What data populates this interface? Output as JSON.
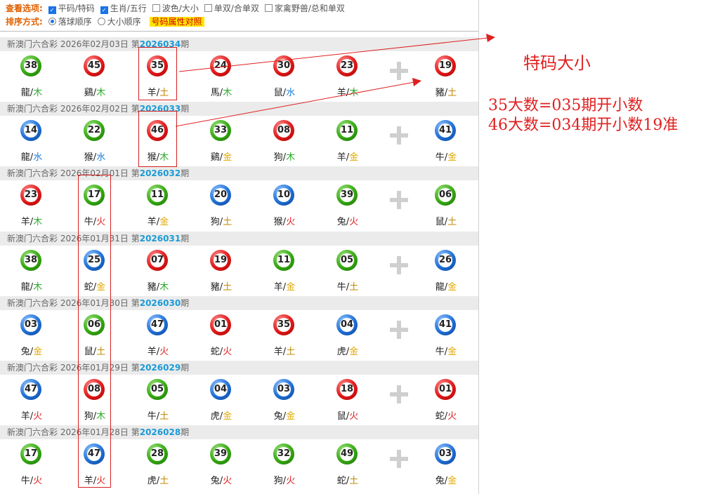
{
  "options": {
    "view_label": "查看选项:",
    "view_items": [
      {
        "label": "平码/特码",
        "checked": true
      },
      {
        "label": "生肖/五行",
        "checked": true
      },
      {
        "label": "波色/大小",
        "checked": false
      },
      {
        "label": "单双/合单双",
        "checked": false
      },
      {
        "label": "家禽野兽/总和单双",
        "checked": false
      }
    ],
    "sort_label": "排序方式:",
    "sort_items": [
      {
        "label": "落球顺序",
        "selected": true
      },
      {
        "label": "大小顺序",
        "selected": false
      }
    ],
    "attr_button": "号码属性对照"
  },
  "colors": {
    "red": "#e01818",
    "green": "#34a810",
    "blue": "#1f6fd6",
    "fire": "#e02020",
    "wood": "#2eaa2e",
    "water": "#1a7ad6",
    "metal": "#e0a800",
    "earth": "#c08a00"
  },
  "draws": [
    {
      "prefix": "新澳门六合彩 2026年02月03日 第",
      "issue": "2026034",
      "suffix": "期",
      "balls": [
        {
          "num": "38",
          "color": "green",
          "zodiac": "龍",
          "element": "木",
          "ecolor": "wood"
        },
        {
          "num": "45",
          "color": "red",
          "zodiac": "鷄",
          "element": "木",
          "ecolor": "wood"
        },
        {
          "num": "35",
          "color": "red",
          "zodiac": "羊",
          "element": "土",
          "ecolor": "earth"
        },
        {
          "num": "24",
          "color": "red",
          "zodiac": "馬",
          "element": "木",
          "ecolor": "wood"
        },
        {
          "num": "30",
          "color": "red",
          "zodiac": "鼠",
          "element": "水",
          "ecolor": "water"
        },
        {
          "num": "23",
          "color": "red",
          "zodiac": "羊",
          "element": "木",
          "ecolor": "wood"
        }
      ],
      "special": {
        "num": "19",
        "color": "red",
        "zodiac": "豬",
        "element": "土",
        "ecolor": "earth"
      }
    },
    {
      "prefix": "新澳门六合彩 2026年02月02日 第",
      "issue": "2026033",
      "suffix": "期",
      "balls": [
        {
          "num": "14",
          "color": "blue",
          "zodiac": "龍",
          "element": "水",
          "ecolor": "water"
        },
        {
          "num": "22",
          "color": "green",
          "zodiac": "猴",
          "element": "水",
          "ecolor": "water"
        },
        {
          "num": "46",
          "color": "red",
          "zodiac": "猴",
          "element": "木",
          "ecolor": "wood"
        },
        {
          "num": "33",
          "color": "green",
          "zodiac": "鷄",
          "element": "金",
          "ecolor": "metal"
        },
        {
          "num": "08",
          "color": "red",
          "zodiac": "狗",
          "element": "木",
          "ecolor": "wood"
        },
        {
          "num": "11",
          "color": "green",
          "zodiac": "羊",
          "element": "金",
          "ecolor": "metal"
        }
      ],
      "special": {
        "num": "41",
        "color": "blue",
        "zodiac": "牛",
        "element": "金",
        "ecolor": "metal"
      }
    },
    {
      "prefix": "新澳门六合彩 2026年02月01日 第",
      "issue": "2026032",
      "suffix": "期",
      "balls": [
        {
          "num": "23",
          "color": "red",
          "zodiac": "羊",
          "element": "木",
          "ecolor": "wood"
        },
        {
          "num": "17",
          "color": "green",
          "zodiac": "牛",
          "element": "火",
          "ecolor": "fire"
        },
        {
          "num": "11",
          "color": "green",
          "zodiac": "羊",
          "element": "金",
          "ecolor": "metal"
        },
        {
          "num": "20",
          "color": "blue",
          "zodiac": "狗",
          "element": "土",
          "ecolor": "earth"
        },
        {
          "num": "10",
          "color": "blue",
          "zodiac": "猴",
          "element": "火",
          "ecolor": "fire"
        },
        {
          "num": "39",
          "color": "green",
          "zodiac": "兔",
          "element": "火",
          "ecolor": "fire"
        }
      ],
      "special": {
        "num": "06",
        "color": "green",
        "zodiac": "鼠",
        "element": "土",
        "ecolor": "earth"
      }
    },
    {
      "prefix": "新澳门六合彩 2026年01月31日 第",
      "issue": "2026031",
      "suffix": "期",
      "balls": [
        {
          "num": "38",
          "color": "green",
          "zodiac": "龍",
          "element": "木",
          "ecolor": "wood"
        },
        {
          "num": "25",
          "color": "blue",
          "zodiac": "蛇",
          "element": "金",
          "ecolor": "metal"
        },
        {
          "num": "07",
          "color": "red",
          "zodiac": "豬",
          "element": "木",
          "ecolor": "wood"
        },
        {
          "num": "19",
          "color": "red",
          "zodiac": "豬",
          "element": "土",
          "ecolor": "earth"
        },
        {
          "num": "11",
          "color": "green",
          "zodiac": "羊",
          "element": "金",
          "ecolor": "metal"
        },
        {
          "num": "05",
          "color": "green",
          "zodiac": "牛",
          "element": "土",
          "ecolor": "earth"
        }
      ],
      "special": {
        "num": "26",
        "color": "blue",
        "zodiac": "龍",
        "element": "金",
        "ecolor": "metal"
      }
    },
    {
      "prefix": "新澳门六合彩 2026年01月30日 第",
      "issue": "2026030",
      "suffix": "期",
      "balls": [
        {
          "num": "03",
          "color": "blue",
          "zodiac": "兔",
          "element": "金",
          "ecolor": "metal"
        },
        {
          "num": "06",
          "color": "green",
          "zodiac": "鼠",
          "element": "土",
          "ecolor": "earth"
        },
        {
          "num": "47",
          "color": "blue",
          "zodiac": "羊",
          "element": "火",
          "ecolor": "fire"
        },
        {
          "num": "01",
          "color": "red",
          "zodiac": "蛇",
          "element": "火",
          "ecolor": "fire"
        },
        {
          "num": "35",
          "color": "red",
          "zodiac": "羊",
          "element": "土",
          "ecolor": "earth"
        },
        {
          "num": "04",
          "color": "blue",
          "zodiac": "虎",
          "element": "金",
          "ecolor": "metal"
        }
      ],
      "special": {
        "num": "41",
        "color": "blue",
        "zodiac": "牛",
        "element": "金",
        "ecolor": "metal"
      }
    },
    {
      "prefix": "新澳门六合彩 2026年01月29日 第",
      "issue": "2026029",
      "suffix": "期",
      "balls": [
        {
          "num": "47",
          "color": "blue",
          "zodiac": "羊",
          "element": "火",
          "ecolor": "fire"
        },
        {
          "num": "08",
          "color": "red",
          "zodiac": "狗",
          "element": "木",
          "ecolor": "wood"
        },
        {
          "num": "05",
          "color": "green",
          "zodiac": "牛",
          "element": "土",
          "ecolor": "earth"
        },
        {
          "num": "04",
          "color": "blue",
          "zodiac": "虎",
          "element": "金",
          "ecolor": "metal"
        },
        {
          "num": "03",
          "color": "blue",
          "zodiac": "兔",
          "element": "金",
          "ecolor": "metal"
        },
        {
          "num": "18",
          "color": "red",
          "zodiac": "鼠",
          "element": "火",
          "ecolor": "fire"
        }
      ],
      "special": {
        "num": "01",
        "color": "red",
        "zodiac": "蛇",
        "element": "火",
        "ecolor": "fire"
      }
    },
    {
      "prefix": "新澳门六合彩 2026年01月28日 第",
      "issue": "2026028",
      "suffix": "期",
      "balls": [
        {
          "num": "17",
          "color": "green",
          "zodiac": "牛",
          "element": "火",
          "ecolor": "fire"
        },
        {
          "num": "47",
          "color": "blue",
          "zodiac": "羊",
          "element": "火",
          "ecolor": "fire"
        },
        {
          "num": "28",
          "color": "green",
          "zodiac": "虎",
          "element": "土",
          "ecolor": "earth"
        },
        {
          "num": "39",
          "color": "green",
          "zodiac": "兔",
          "element": "火",
          "ecolor": "fire"
        },
        {
          "num": "32",
          "color": "green",
          "zodiac": "狗",
          "element": "火",
          "ecolor": "fire"
        },
        {
          "num": "49",
          "color": "green",
          "zodiac": "蛇",
          "element": "土",
          "ecolor": "earth"
        }
      ],
      "special": {
        "num": "03",
        "color": "blue",
        "zodiac": "兔",
        "element": "金",
        "ecolor": "metal"
      }
    }
  ],
  "annotations": {
    "title": "特码大小",
    "line1": "35大数=035期开小数",
    "line2": "46大数=034期开小数19准"
  }
}
